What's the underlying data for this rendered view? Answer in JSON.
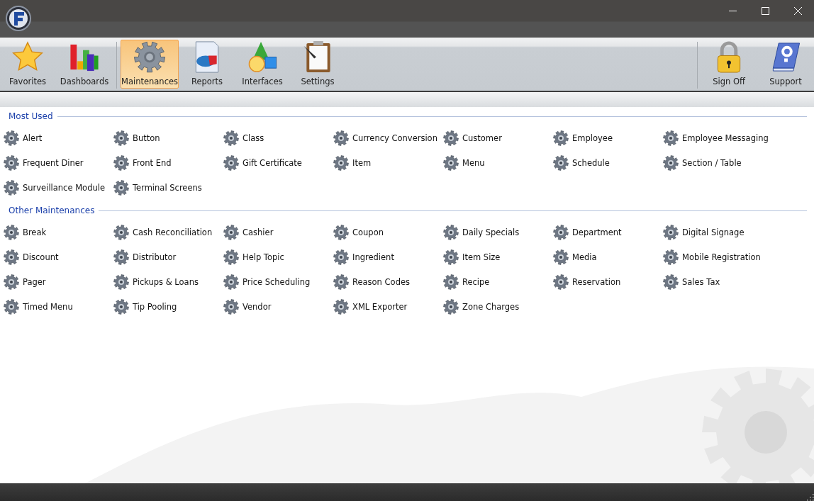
{
  "toolbar": {
    "left": [
      {
        "label": "Favorites",
        "kind": "star",
        "selected": false
      },
      {
        "label": "Dashboards",
        "kind": "bars",
        "selected": false
      },
      {
        "label": "Maintenances",
        "kind": "gear",
        "selected": true
      },
      {
        "label": "Reports",
        "kind": "report",
        "selected": false
      },
      {
        "label": "Interfaces",
        "kind": "shapes",
        "selected": false
      },
      {
        "label": "Settings",
        "kind": "clipboard",
        "selected": false
      }
    ],
    "right": [
      {
        "label": "Sign Off",
        "kind": "lock",
        "selected": false
      },
      {
        "label": "Support",
        "kind": "book",
        "selected": false
      }
    ]
  },
  "sections": [
    {
      "title": "Most Used",
      "items": [
        "Alert",
        "Button",
        "Class",
        "Currency Conversion",
        "Customer",
        "Employee",
        "Employee Messaging",
        "Frequent Diner",
        "Front End",
        "Gift Certificate",
        "Item",
        "Menu",
        "Schedule",
        "Section / Table",
        "Surveillance Module",
        "Terminal Screens"
      ]
    },
    {
      "title": "Other Maintenances",
      "items": [
        "Break",
        "Cash Reconciliation",
        "Cashier",
        "Coupon",
        "Daily Specials",
        "Department",
        "Digital Signage",
        "Discount",
        "Distributor",
        "Help Topic",
        "Ingredient",
        "Item Size",
        "Media",
        "Mobile Registration",
        "Pager",
        "Pickups & Loans",
        "Price Scheduling",
        "Reason Codes",
        "Recipe",
        "Reservation",
        "Sales Tax",
        "Timed Menu",
        "Tip Pooling",
        "Vendor",
        "XML Exporter",
        "Zone Charges"
      ]
    }
  ]
}
